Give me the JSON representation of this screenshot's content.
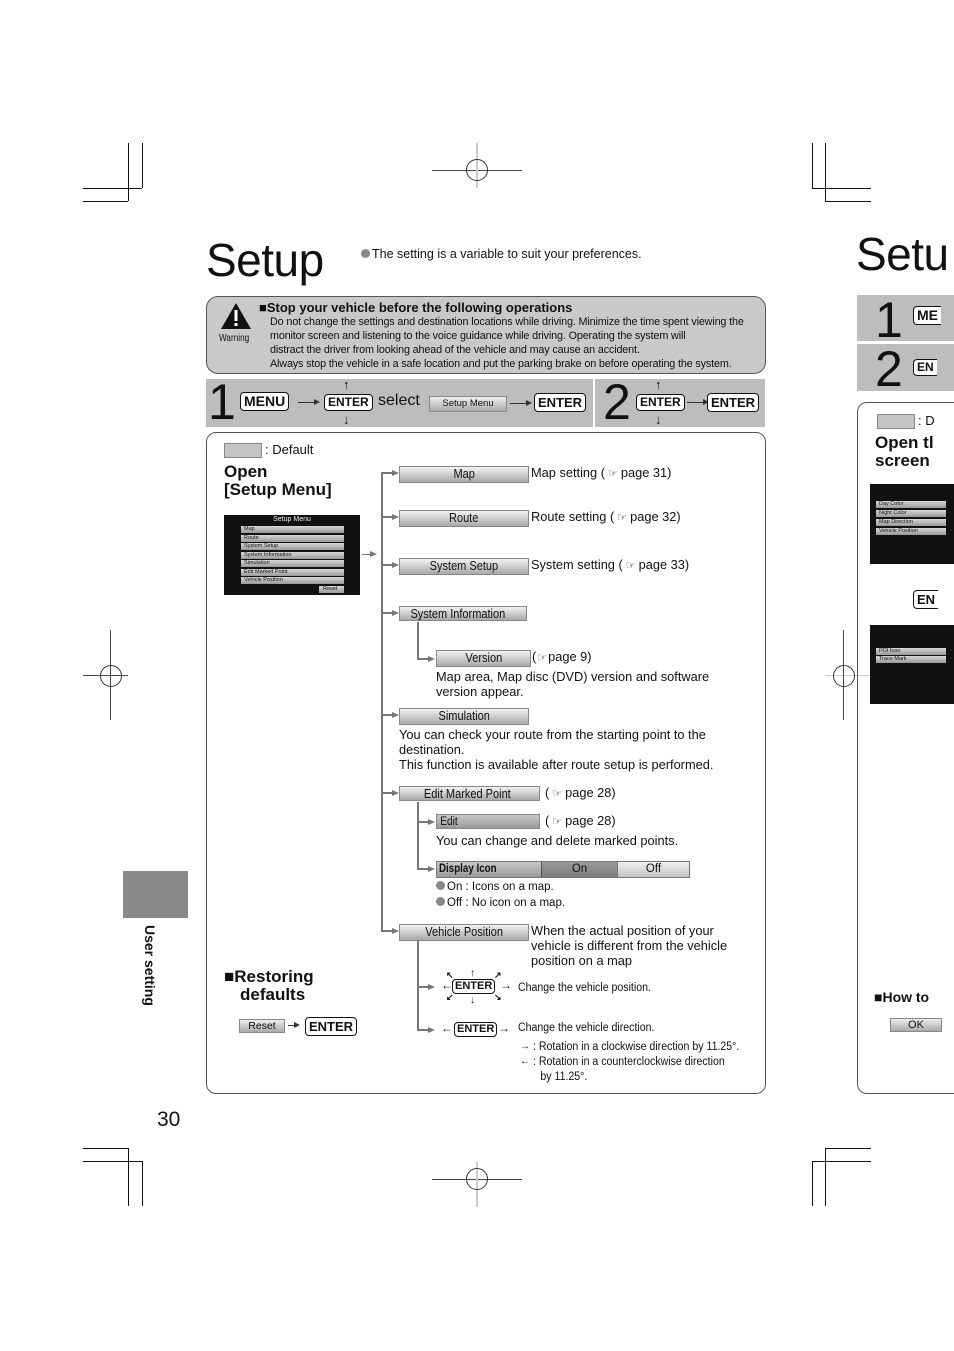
{
  "page": {
    "title": "Setup",
    "intro_note": "The setting is a variable to suit your preferences.",
    "page_number": "30",
    "side_tab_label": "User setting"
  },
  "warning": {
    "icon_label": "Warning",
    "heading": "■Stop your vehicle before the following operations",
    "lines": [
      "Do not change the settings and destination locations while driving. Minimize the time spent viewing the",
      "monitor screen and listening to the voice guidance while driving.  Operating the system will",
      "distract the driver from looking ahead of the vehicle and may cause an accident.",
      "Always stop the vehicle in a safe location and put the parking brake on before operating the system."
    ]
  },
  "steps": {
    "step1": {
      "number": "1",
      "menu_key": "MENU",
      "enter_key": "ENTER",
      "select_word": "select",
      "select_button": "Setup  Menu",
      "enter_key2": "ENTER"
    },
    "step2": {
      "number": "2",
      "enter_key": "ENTER",
      "enter_key2": "ENTER"
    }
  },
  "main": {
    "default_legend": ": Default",
    "open_heading_1": "Open",
    "open_heading_2": "[Setup Menu]",
    "screen": {
      "title": "Setup  Menu",
      "items": [
        "Map",
        "Route",
        "System  Setup",
        "System  Information",
        "Simulation",
        "Edit  Marked  Point",
        "Vehicle  Position"
      ],
      "reset": "Reset"
    },
    "tree": {
      "map": {
        "label": "Map",
        "desc": "Map setting (",
        "page": "page 31)"
      },
      "route": {
        "label": "Route",
        "desc": "Route setting (",
        "page": "page 32)"
      },
      "system_setup": {
        "label": "System  Setup",
        "desc": "System setting (",
        "page": "page 33)"
      },
      "system_information": {
        "label": "System  Information"
      },
      "version": {
        "label": "Version",
        "desc": "(",
        "page": "page 9)",
        "line1": "Map area, Map disc (DVD) version and software",
        "line2": "version appear."
      },
      "simulation": {
        "label": "Simulation",
        "line1": "You can check your route from the starting point to the",
        "line2": "destination.",
        "line3": "This function is available after route setup is performed."
      },
      "edit_marked_point": {
        "label": "Edit  Marked  Point",
        "desc": "(",
        "page": "page 28)"
      },
      "edit": {
        "label": "Edit",
        "desc": "(",
        "page": "page 28)",
        "line1": "You can change and delete marked points."
      },
      "display_icon": {
        "label": "Display  Icon",
        "on": "On",
        "off": "Off",
        "on_desc": "On : Icons on a map.",
        "off_desc": "Off : No icon on a map."
      },
      "vehicle_position": {
        "label": "Vehicle  Position",
        "line1": "When the actual position of your",
        "line2": "vehicle is different from the vehicle",
        "line3": "position on a map"
      },
      "change_position": {
        "key": "ENTER",
        "desc": "Change the vehicle position."
      },
      "change_direction": {
        "key": "ENTER",
        "desc": "Change the vehicle direction.",
        "cw": ": Rotation in a clockwise direction by 11.25°.",
        "ccw_1": ": Rotation in a counterclockwise direction",
        "ccw_2": "by 11.25°."
      }
    },
    "restoring": {
      "heading_1": "■Restoring",
      "heading_2": "defaults",
      "reset_button": "Reset",
      "enter_key": "ENTER"
    }
  },
  "next_page": {
    "title": "Setu",
    "step1_key": "ME",
    "step2_key": "EN",
    "default_legend": ": D",
    "open_1": "Open tl",
    "open_2": "screen",
    "screen1_items": [
      "Day  Color",
      "Night  Color",
      "Map  Direction",
      "Vehicle  Position"
    ],
    "enter_key": "EN",
    "screen2_items": [
      "POI  Icon",
      "Trace  Mark"
    ],
    "how_to": "■How to",
    "ok_button": "OK"
  },
  "colors": {
    "panel_grey": "#c9c9c9",
    "step_grey": "#bdbdbd",
    "side_tab": "#8a8a8a"
  }
}
